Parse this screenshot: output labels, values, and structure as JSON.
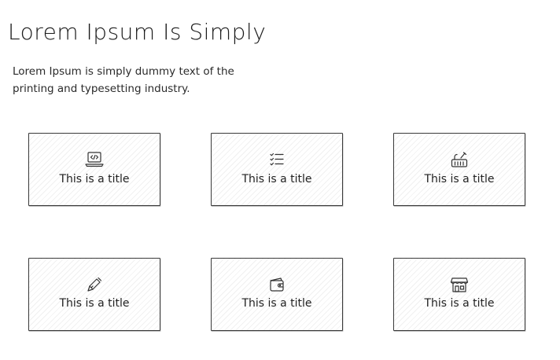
{
  "header": {
    "title": "Lorem Ipsum Is Simply",
    "subtitle": "Lorem Ipsum is simply dummy text of the printing and typesetting industry."
  },
  "cards": [
    {
      "title": "This is a title",
      "icon": "laptop-code-icon"
    },
    {
      "title": "This is a title",
      "icon": "list-checks-icon"
    },
    {
      "title": "This is a title",
      "icon": "tools-box-icon"
    },
    {
      "title": "This is a title",
      "icon": "pen-icon"
    },
    {
      "title": "This is a title",
      "icon": "wallet-icon"
    },
    {
      "title": "This is a title",
      "icon": "store-icon"
    }
  ]
}
